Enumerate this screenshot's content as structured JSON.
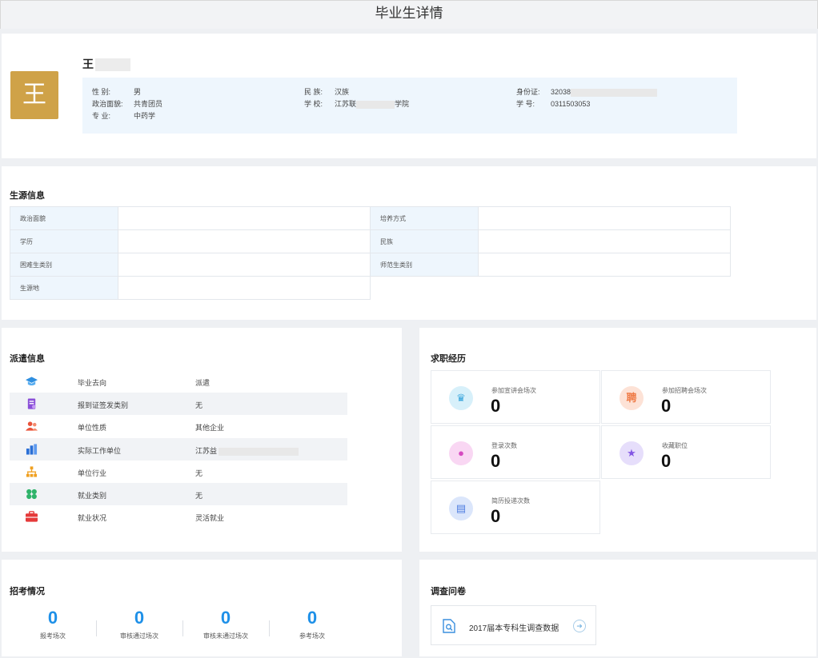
{
  "window": {
    "title": "毕业生详情"
  },
  "profile": {
    "avatar_char": "王",
    "name": "王",
    "fields": {
      "gender_label": "性    别:",
      "gender": "男",
      "ethnic_label": "民    族:",
      "ethnic": "汉族",
      "idcard_label": "身份证:",
      "idcard": "32038",
      "politics_label": "政治面貌:",
      "politics": "共青团员",
      "school_label": "学    校:",
      "school_prefix": "江苏联",
      "school_suffix": "学院",
      "stuno_label": "学    号:",
      "stuno": "0311503053",
      "major_label": "专    业:",
      "major": "中药学"
    }
  },
  "source": {
    "title": "生源信息",
    "rows": [
      {
        "k1": "政治面貌",
        "v1": "",
        "k2": "培养方式",
        "v2": ""
      },
      {
        "k1": "学历",
        "v1": "",
        "k2": "民族",
        "v2": ""
      },
      {
        "k1": "困难生类别",
        "v1": "",
        "k2": "师范生类别",
        "v2": ""
      },
      {
        "k1": "生源地",
        "v1": ""
      }
    ]
  },
  "dispatch": {
    "title": "派遣信息",
    "rows": [
      {
        "icon": "graduation-cap-icon",
        "key": "毕业去向",
        "value": "派遣"
      },
      {
        "icon": "certificate-icon",
        "key": "报到证签发类别",
        "value": "无"
      },
      {
        "icon": "users-icon",
        "key": "单位性质",
        "value": "其他企业"
      },
      {
        "icon": "building-icon",
        "key": "实际工作单位",
        "value": "江苏益"
      },
      {
        "icon": "org-chart-icon",
        "key": "单位行业",
        "value": "无"
      },
      {
        "icon": "clover-icon",
        "key": "就业类别",
        "value": "无"
      },
      {
        "icon": "briefcase-icon",
        "key": "就业状况",
        "value": "灵活就业"
      }
    ]
  },
  "job": {
    "title": "求职经历",
    "stats": [
      {
        "icon": "trophy-icon",
        "label": "参加宣讲会场次",
        "value": "0",
        "bg": "#d7f0fa",
        "fg": "#3aa6dc",
        "glyph": "♛"
      },
      {
        "icon": "recruit-icon",
        "label": "参加招聘会场次",
        "value": "0",
        "bg": "#fde2d6",
        "fg": "#ef7a45",
        "glyph": "聘"
      },
      {
        "icon": "person-icon",
        "label": "登录次数",
        "value": "0",
        "bg": "#f9d7f3",
        "fg": "#d64bc0",
        "glyph": "●"
      },
      {
        "icon": "star-icon",
        "label": "收藏职位",
        "value": "0",
        "bg": "#e6defb",
        "fg": "#8357e4",
        "glyph": "★"
      },
      {
        "icon": "resume-icon",
        "label": "简历投递次数",
        "value": "0",
        "bg": "#dbe6fb",
        "fg": "#4e7de0",
        "glyph": "▤"
      }
    ]
  },
  "exam": {
    "title": "招考情况",
    "items": [
      {
        "value": "0",
        "label": "报考场次"
      },
      {
        "value": "0",
        "label": "审核通过场次"
      },
      {
        "value": "0",
        "label": "审核未通过场次"
      },
      {
        "value": "0",
        "label": "参考场次"
      }
    ]
  },
  "survey": {
    "title": "调查问卷",
    "item_label": "2017届本专科生调查数据"
  },
  "colors": {
    "accent": "#1e90e8",
    "avatar_bg": "#cfa248",
    "info_bg": "#eef6fd"
  }
}
